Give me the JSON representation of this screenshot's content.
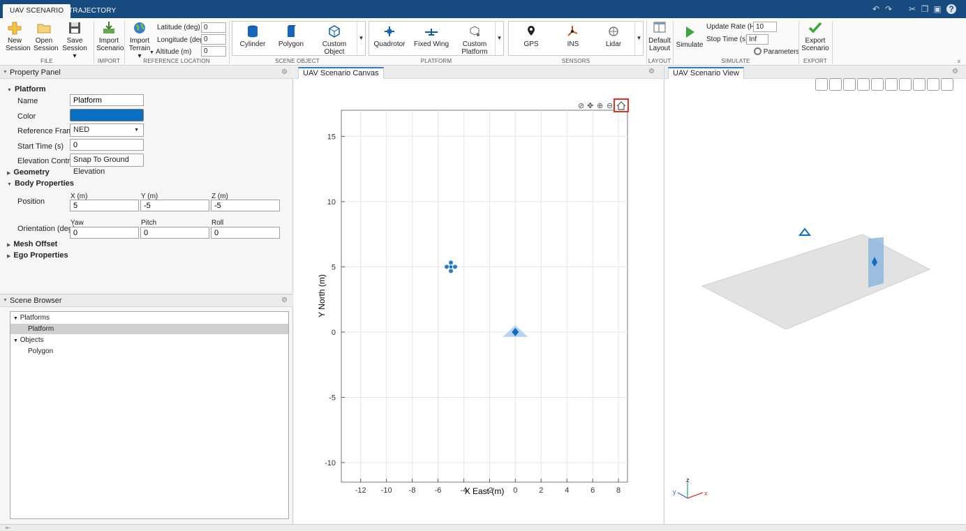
{
  "tabs": [
    "UAV SCENARIO",
    "TRAJECTORY"
  ],
  "toolstrip": {
    "file": {
      "new_session": [
        "New",
        "Session"
      ],
      "open_session": [
        "Open",
        "Session"
      ],
      "save_session": [
        "Save",
        "Session ▾"
      ],
      "label": "FILE"
    },
    "import": {
      "import_scenario": [
        "Import",
        "Scenario"
      ],
      "label": "IMPORT"
    },
    "reference": {
      "import_terrain": [
        "Import",
        "Terrain ▾"
      ],
      "latitude_label": "Latitude (deg)",
      "latitude": "0",
      "longitude_label": "Longitude (deg)",
      "longitude": "0",
      "altitude_label": "Altitude (m)",
      "altitude": "0",
      "label": "REFERENCE LOCATION"
    },
    "scene_object": {
      "items": [
        "Cylinder",
        "Polygon",
        "Custom Object"
      ],
      "label": "SCENE OBJECT"
    },
    "platform": {
      "items": [
        "Quadrotor",
        "Fixed Wing",
        "Custom Platform"
      ],
      "label": "PLATFORM"
    },
    "sensors": {
      "items": [
        "GPS",
        "INS",
        "Lidar"
      ],
      "label": "SENSORS"
    },
    "layout": {
      "default_layout": [
        "Default",
        "Layout"
      ],
      "label": "LAYOUT"
    },
    "simulate": {
      "simulate": "Simulate",
      "update_rate_label": "Update Rate (Hz)",
      "update_rate": "10",
      "stop_time_label": "Stop Time (s)",
      "stop_time": "Inf",
      "parameters": "Parameters",
      "label": "SIMULATE"
    },
    "export": {
      "export_scenario": [
        "Export",
        "Scenario"
      ],
      "label": "EXPORT"
    }
  },
  "property_panel": {
    "title": "Property Panel",
    "platform_section": "Platform",
    "name_label": "Name",
    "name_value": "Platform",
    "color_label": "Color",
    "color_value": "#0a6fc2",
    "ref_frame_label": "Reference Frame",
    "ref_frame_value": "NED",
    "start_time_label": "Start Time (s)",
    "start_time_value": "0",
    "elevation_label": "Elevation Control",
    "elevation_button": "Snap To Ground Elevation",
    "geometry_section": "Geometry",
    "body_section": "Body Properties",
    "position_label": "Position",
    "x_label": "X (m)",
    "y_label": "Y (m)",
    "z_label": "Z (m)",
    "x_value": "5",
    "y_value": "-5",
    "z_value": "-5",
    "orientation_label": "Orientation (deg)",
    "yaw_label": "Yaw",
    "pitch_label": "Pitch",
    "roll_label": "Roll",
    "yaw_value": "0",
    "pitch_value": "0",
    "roll_value": "0",
    "mesh_section": "Mesh Offset",
    "ego_section": "Ego Properties"
  },
  "scene_browser": {
    "title": "Scene Browser",
    "platforms_label": "Platforms",
    "platform_item": "Platform",
    "objects_label": "Objects",
    "object_item": "Polygon"
  },
  "canvas": {
    "tab": "UAV Scenario Canvas",
    "chart_data": {
      "type": "scatter",
      "xlabel": "X East (m)",
      "ylabel": "Y North (m)",
      "xlim": [
        -13.5,
        8.7
      ],
      "ylim": [
        -11.5,
        17
      ],
      "xticks": [
        -12,
        -10,
        -8,
        -6,
        -4,
        -2,
        0,
        2,
        4,
        6,
        8
      ],
      "yticks": [
        -10,
        -5,
        0,
        5,
        10,
        15
      ],
      "grid": true,
      "platform": {
        "x": -5,
        "y": 5
      },
      "polygon_marker": {
        "x": 0,
        "y": 0
      }
    }
  },
  "view3d": {
    "tab": "UAV Scenario View",
    "axis_z": "z",
    "axis_x": "x",
    "axis_y": "y"
  },
  "colors": {
    "accent": "#2f7bc6",
    "titlebar": "#174a7e",
    "platform_blue": "#0a6fc2",
    "highlight": "#e0302a"
  }
}
